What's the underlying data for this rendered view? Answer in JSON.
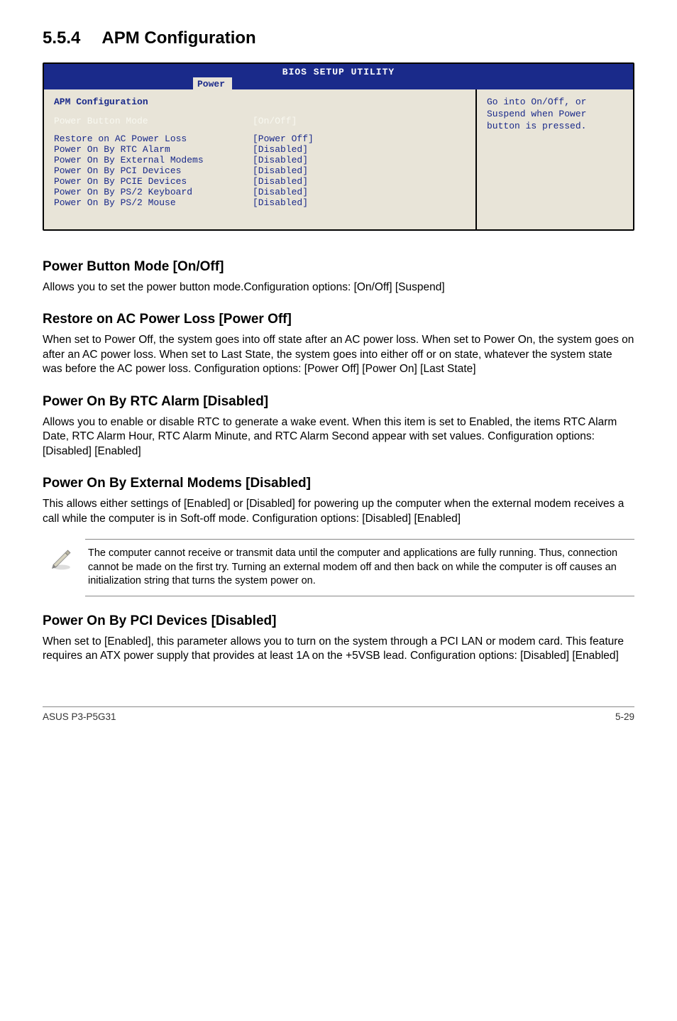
{
  "section": {
    "number": "5.5.4",
    "title": "APM Configuration"
  },
  "bios": {
    "header": "BIOS SETUP UTILITY",
    "tab": "Power",
    "panel_title": "APM Configuration",
    "rows": [
      {
        "label": "Power Button Mode",
        "value": "[On/Off]",
        "cls": "white-row"
      },
      {
        "label": "Restore on AC Power Loss",
        "value": "[Power Off]",
        "cls": "blue-row"
      },
      {
        "label": "Power On By RTC Alarm",
        "value": "[Disabled]",
        "cls": "blue-row"
      },
      {
        "label": "Power On By External Modems",
        "value": "[Disabled]",
        "cls": "blue-row"
      },
      {
        "label": "Power On By PCI Devices",
        "value": "[Disabled]",
        "cls": "blue-row"
      },
      {
        "label": "Power On By PCIE Devices",
        "value": "[Disabled]",
        "cls": "blue-row"
      },
      {
        "label": "Power On By PS/2 Keyboard",
        "value": "[Disabled]",
        "cls": "blue-row"
      },
      {
        "label": "Power On By PS/2 Mouse",
        "value": "[Disabled]",
        "cls": "blue-row"
      }
    ],
    "help": "Go into On/Off, or Suspend when Power button is pressed."
  },
  "subsections": [
    {
      "heading": "Power Button Mode [On/Off]",
      "body": "Allows you to set the power button mode.Configuration options: [On/Off] [Suspend]"
    },
    {
      "heading": "Restore on AC Power Loss [Power Off]",
      "body": "When set to Power Off, the system goes into off state after an AC power loss. When set to Power On, the system goes on after an AC power loss. When set to Last State, the system goes into either off or on state, whatever the system state was before the AC power loss. Configuration options: [Power Off] [Power On] [Last State]"
    },
    {
      "heading": "Power On By RTC Alarm [Disabled]",
      "body": "Allows you to enable or disable RTC to generate a wake event. When this item is set to Enabled, the items RTC Alarm Date, RTC Alarm Hour, RTC Alarm Minute, and RTC Alarm Second appear with set values. Configuration options: [Disabled] [Enabled]"
    },
    {
      "heading": "Power On By External Modems [Disabled]",
      "body": "This allows either settings of [Enabled] or [Disabled] for powering up the computer when the external modem receives a call while the computer is in Soft-off mode. Configuration options: [Disabled] [Enabled]"
    }
  ],
  "note": "The computer cannot receive or transmit data until the computer and applications are fully running. Thus, connection cannot be made on the first try. Turning an external modem off and then back on while the computer is off causes an initialization string that turns the system power on.",
  "after_note": {
    "heading": "Power On By PCI Devices [Disabled]",
    "body": "When set to [Enabled], this parameter allows you to turn on the system through a PCI LAN or modem card. This feature requires an ATX power supply that provides at least 1A on the +5VSB lead. Configuration options: [Disabled] [Enabled]"
  },
  "footer": {
    "left": "ASUS P3-P5G31",
    "right": "5-29"
  }
}
